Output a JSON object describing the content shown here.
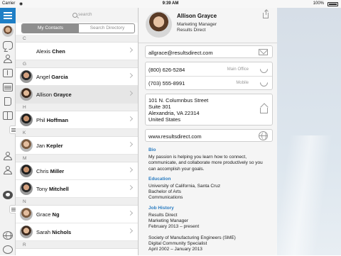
{
  "status": {
    "carrier": "Carrier",
    "time": "9:39 AM",
    "battery": "100%"
  },
  "search": {
    "placeholder": "search"
  },
  "segments": {
    "my_contacts": "My Contacts",
    "directory": "Search Directory"
  },
  "contacts": [
    {
      "type": "section",
      "letter": "C"
    },
    {
      "type": "contact",
      "first": "Alexis",
      "last": "Chen",
      "photo": false
    },
    {
      "type": "section",
      "letter": "G"
    },
    {
      "type": "contact",
      "first": "Angel",
      "last": "Garcia",
      "photo": true,
      "style": "pc2"
    },
    {
      "type": "contact",
      "first": "Allison",
      "last": "Grayce",
      "photo": true,
      "style": "pc1",
      "selected": true
    },
    {
      "type": "section",
      "letter": "H"
    },
    {
      "type": "contact",
      "first": "Phil",
      "last": "Hoffman",
      "photo": true,
      "style": "pc4"
    },
    {
      "type": "section",
      "letter": "K"
    },
    {
      "type": "contact",
      "first": "Jan",
      "last": "Kepler",
      "photo": true,
      "style": "pc3"
    },
    {
      "type": "section",
      "letter": "M"
    },
    {
      "type": "contact",
      "first": "Chris",
      "last": "Miller",
      "photo": true,
      "style": "pc4"
    },
    {
      "type": "contact",
      "first": "Tony",
      "last": "Mitchell",
      "photo": true,
      "style": "pc2"
    },
    {
      "type": "section",
      "letter": "N"
    },
    {
      "type": "contact",
      "first": "Grace",
      "last": "Ng",
      "photo": true,
      "style": "pc3"
    },
    {
      "type": "contact",
      "first": "Sarah",
      "last": "Nichols",
      "photo": true,
      "style": "pc1"
    },
    {
      "type": "section",
      "letter": "R"
    }
  ],
  "detail": {
    "name": "Allison Grayce",
    "title": "Marketing Manager",
    "company": "Results Direct",
    "email": "allgrace@resultsdirect.com",
    "phones": [
      {
        "number": "(800) 626-5284",
        "label": "Main Office"
      },
      {
        "number": "(703) 555-8991",
        "label": "Mobile"
      }
    ],
    "address": [
      "101 N. Columnbus Street",
      "Suite 301",
      "Alexandria, VA 22314",
      "United States"
    ],
    "website": "www.resultsdirect.com",
    "bio_title": "Bio",
    "bio": "My passion is helping you learn how to connect, communicate, and collaborate more productively so you can accomplish your goals.",
    "education_title": "Education",
    "education": [
      "University of California, Santa Cruz",
      "Bachelor of Arts",
      "Communications"
    ],
    "job_title": "Job History",
    "jobs": [
      [
        "Results Direct",
        "Marketing Manager",
        "February 2013 – present"
      ],
      [
        "Society of Manufacturing Engineers (SME)",
        "Digital Community Specialist",
        "April 2002 – January 2013"
      ]
    ]
  },
  "colors": {
    "accent": "#1f7fc6",
    "section_title": "#2a7cc1"
  }
}
